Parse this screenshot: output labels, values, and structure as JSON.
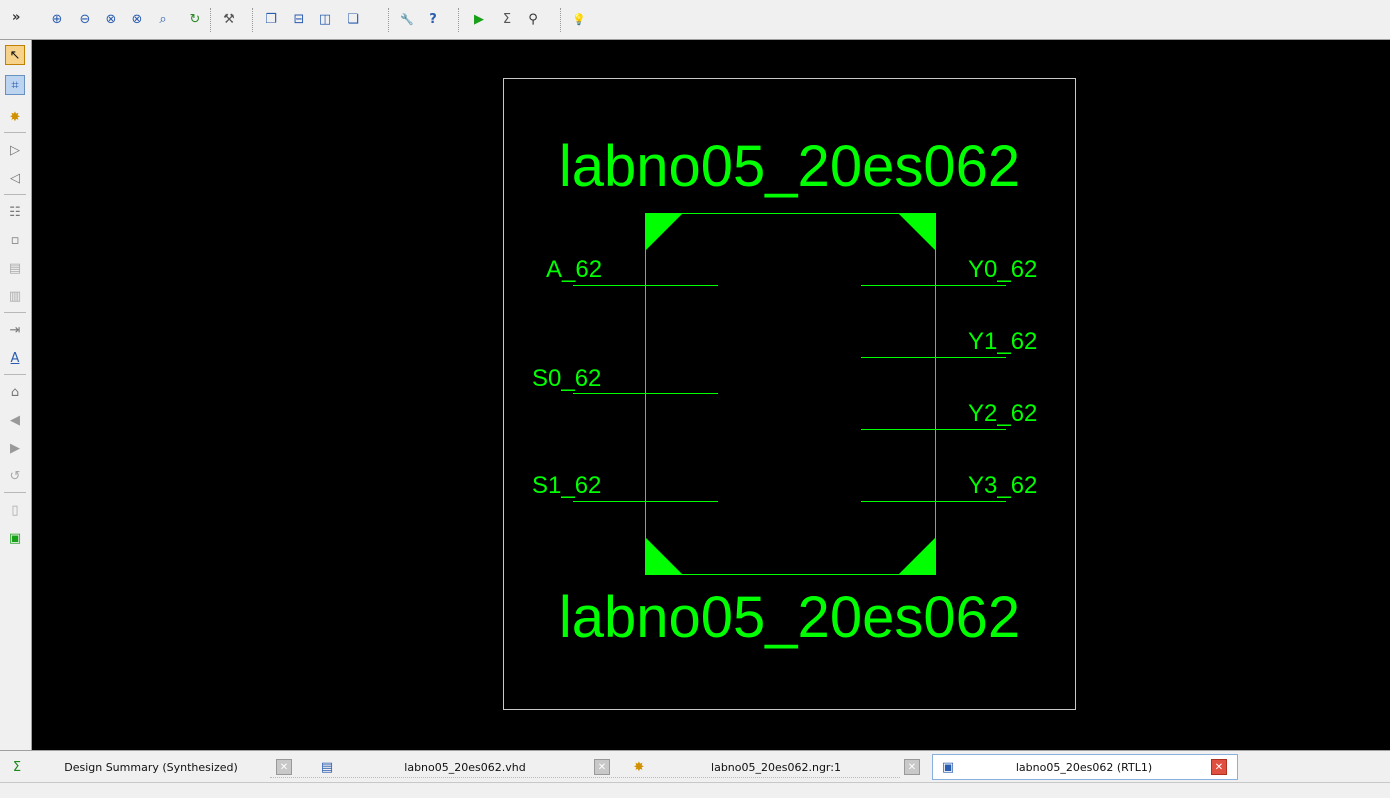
{
  "toolbar": {
    "overflow": "»",
    "buttons": [
      {
        "name": "zoom-in-icon",
        "glyph": "⊕"
      },
      {
        "name": "zoom-out-icon",
        "glyph": "⊖"
      },
      {
        "name": "zoom-full-view-icon",
        "glyph": "⊗"
      },
      {
        "name": "zoom-to-selected-icon",
        "glyph": "⊗"
      },
      {
        "name": "zoom-magnifier-icon",
        "glyph": "⌕"
      },
      {
        "name": "refresh-icon",
        "glyph": "↻"
      },
      {
        "name": "hammer-icon",
        "glyph": "⚒"
      },
      {
        "name": "cascade-windows-icon",
        "glyph": "❐"
      },
      {
        "name": "tile-horizontal-icon",
        "glyph": "⊟"
      },
      {
        "name": "tile-vertical-icon",
        "glyph": "◫"
      },
      {
        "name": "window-icon",
        "glyph": "❏"
      },
      {
        "name": "wrench-icon",
        "glyph": "🔧"
      },
      {
        "name": "context-help-icon",
        "glyph": "?"
      },
      {
        "name": "run-icon",
        "glyph": "▶"
      },
      {
        "name": "sigma-icon",
        "glyph": "Σ"
      },
      {
        "name": "telescope-icon",
        "glyph": "⚲"
      },
      {
        "name": "lightbulb-icon",
        "glyph": "💡"
      }
    ]
  },
  "side_toolbar": [
    {
      "name": "select-pointer-icon",
      "glyph": "↖"
    },
    {
      "name": "select-area-icon",
      "glyph": "⌗"
    },
    {
      "name": "add-element-icon",
      "glyph": "✸"
    },
    {
      "name": "forward-icon",
      "glyph": "▷"
    },
    {
      "name": "backward-icon",
      "glyph": "◁"
    },
    {
      "name": "hierarchy-icon",
      "glyph": "☷"
    },
    {
      "name": "instance-icon",
      "glyph": "▫"
    },
    {
      "name": "push-icon",
      "glyph": "▤"
    },
    {
      "name": "pop-icon",
      "glyph": "▥"
    },
    {
      "name": "expand-icon",
      "glyph": "⇥"
    },
    {
      "name": "annotate-icon",
      "glyph": "A"
    },
    {
      "name": "home-icon",
      "glyph": "⌂"
    },
    {
      "name": "go-back-icon",
      "glyph": "◀"
    },
    {
      "name": "go-forward-icon",
      "glyph": "▶"
    },
    {
      "name": "history-icon",
      "glyph": "↺"
    },
    {
      "name": "window-split-icon",
      "glyph": "▯"
    },
    {
      "name": "run-script-icon",
      "glyph": "▣"
    }
  ],
  "schematic": {
    "title_top": "labno05_20es062",
    "title_bottom": "labno05_20es062",
    "inputs": [
      "A_62",
      "S0_62",
      "S1_62"
    ],
    "outputs": [
      "Y0_62",
      "Y1_62",
      "Y2_62",
      "Y3_62"
    ],
    "colors": {
      "canvas": "#000000",
      "symbol": "#00ff00",
      "frame": "#c8c8c8"
    }
  },
  "tabs": [
    {
      "label": "Design Summary (Synthesized)",
      "icon": "sigma-icon",
      "glyph": "Σ",
      "active": false
    },
    {
      "label": "labno05_20es062.vhd",
      "icon": "document-icon",
      "glyph": "▤",
      "active": false
    },
    {
      "label": "labno05_20es062.ngr:1",
      "icon": "netlist-icon",
      "glyph": "✸",
      "active": false
    },
    {
      "label": "labno05_20es062 (RTL1)",
      "icon": "schematic-icon",
      "glyph": "▣",
      "active": true
    }
  ],
  "close_glyph": "✕"
}
